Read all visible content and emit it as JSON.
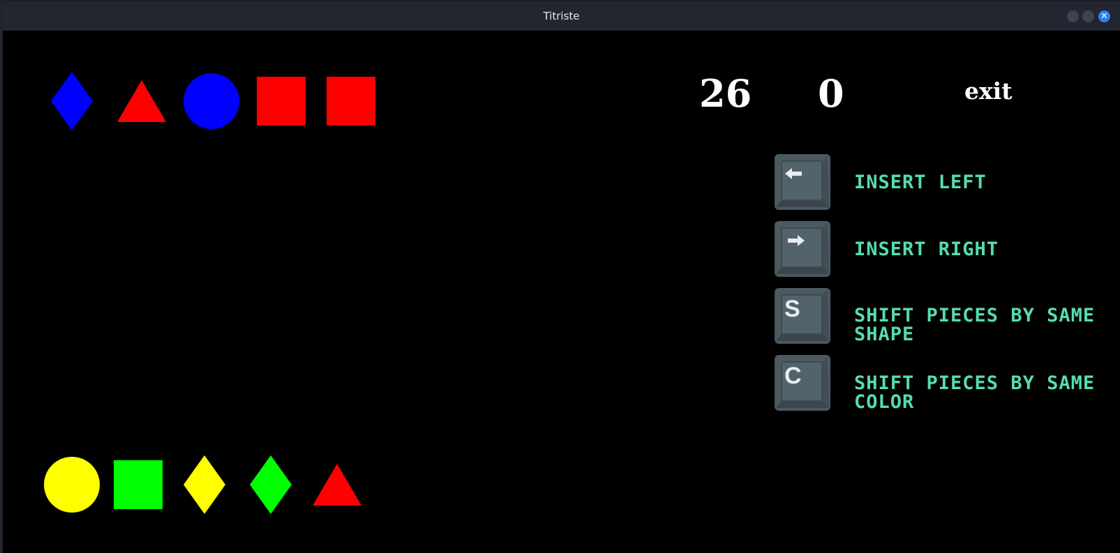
{
  "window": {
    "title": "Titriste"
  },
  "colors": {
    "blue": "#0000ff",
    "red": "#ff0000",
    "yellow": "#ffff00",
    "green": "#00ff00",
    "key_label": "#55dcb0"
  },
  "hud": {
    "score": "26",
    "lines": "0",
    "exit_label": "exit"
  },
  "pieces_top": [
    {
      "shape": "diamond",
      "color": "#0000ff"
    },
    {
      "shape": "triangle",
      "color": "#ff0000"
    },
    {
      "shape": "circle",
      "color": "#0000ff"
    },
    {
      "shape": "square",
      "color": "#ff0000"
    },
    {
      "shape": "square",
      "color": "#ff0000"
    }
  ],
  "pieces_bottom": [
    {
      "shape": "circle",
      "color": "#ffff00"
    },
    {
      "shape": "square",
      "color": "#00ff00"
    },
    {
      "shape": "diamond",
      "color": "#ffff00"
    },
    {
      "shape": "diamond",
      "color": "#00ff00"
    },
    {
      "shape": "triangle",
      "color": "#ff0000"
    }
  ],
  "controls": [
    {
      "key": "arrow-left-icon",
      "label": "INSERT LEFT"
    },
    {
      "key": "arrow-right-icon",
      "label": "INSERT RIGHT"
    },
    {
      "key": "S",
      "label": "SHIFT PIECES BY SAME SHAPE"
    },
    {
      "key": "C",
      "label": "SHIFT PIECES BY SAME COLOR"
    }
  ]
}
